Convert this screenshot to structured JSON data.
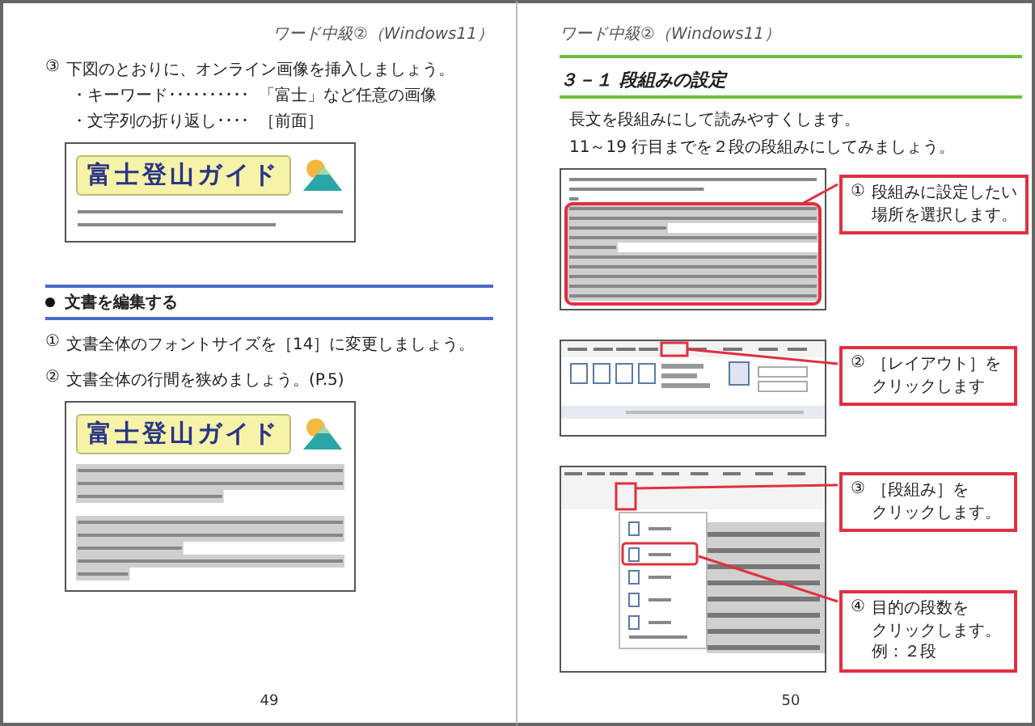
{
  "left_page": {
    "header": "ワード中級②（Windows11）",
    "blocks": [
      {
        "kind": "step",
        "number": "③",
        "text": "下図のとおりに、オンライン画像を挿入しましょう。",
        "bullets": [
          {
            "label": "・キーワード･･････････",
            "value": "「富士」など任意の画像"
          },
          {
            "label": "・文字列の折り返し････",
            "value": "［前面］"
          }
        ]
      },
      {
        "kind": "figure",
        "banner": "富士登山ガイド",
        "highlighted": false
      },
      {
        "kind": "section",
        "title": "文書を編集する"
      },
      {
        "kind": "step",
        "number": "①",
        "text": "文書全体のフォントサイズを［14］に変更しましょう。"
      },
      {
        "kind": "step",
        "number": "②",
        "text": "文書全体の行間を狭めましょう。(P.5)"
      },
      {
        "kind": "figure",
        "banner": "富士登山ガイド",
        "highlighted": true
      }
    ],
    "page_number": "49"
  },
  "right_page": {
    "header": "ワード中級②（Windows11）",
    "title": "３－１ 段組みの設定",
    "intro": [
      "長文を段組みにして読みやすくします。",
      "11～19 行目までを２段の段組みにしてみましょう。"
    ],
    "figures": [
      {
        "kind": "document",
        "callouts": [
          {
            "number": "①",
            "lines": [
              "段組みに設定したい",
              "場所を選択します。"
            ]
          }
        ]
      },
      {
        "kind": "ribbon",
        "callouts": [
          {
            "number": "②",
            "lines": [
              "［レイアウト］を",
              "クリックします"
            ]
          }
        ]
      },
      {
        "kind": "menu",
        "callouts": [
          {
            "number": "③",
            "lines": [
              "［段組み］を",
              "クリックします。"
            ]
          },
          {
            "number": "④",
            "lines": [
              "目的の段数を",
              "クリックします。",
              "例：２段"
            ]
          }
        ]
      }
    ],
    "page_number": "50"
  }
}
